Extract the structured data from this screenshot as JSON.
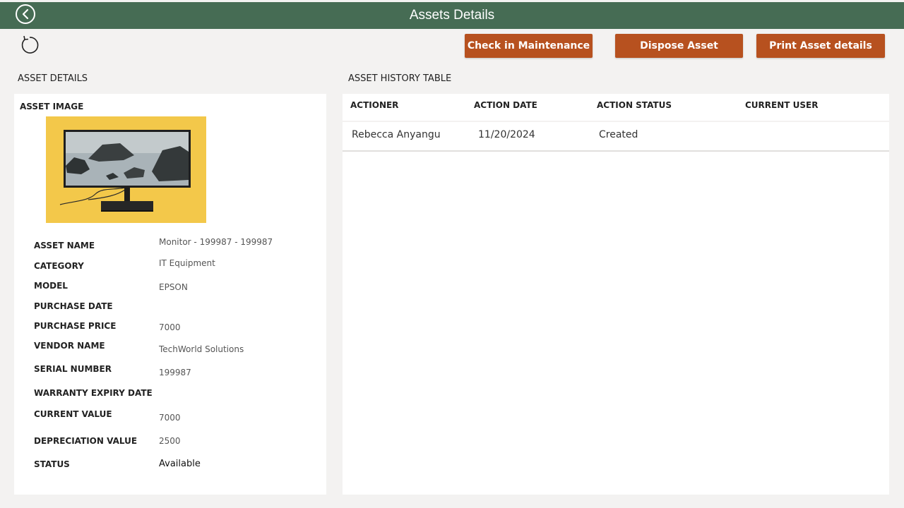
{
  "header": {
    "title": "Assets Details",
    "back_icon": "chevron-left-circle-icon",
    "bg_color": "#466c54"
  },
  "toolbar": {
    "refresh_icon": "refresh-icon",
    "check_maintenance_label": "Check in Maintenance",
    "dispose_label": "Dispose Asset",
    "print_label": "Print Asset details",
    "button_color": "#b7511f"
  },
  "asset_details": {
    "section_title": "ASSET DETAILS",
    "image_title": "ASSET IMAGE",
    "fields": [
      {
        "label": "ASSET NAME",
        "value": "Monitor - 199987 - 199987"
      },
      {
        "label": "CATEGORY",
        "value": "IT Equipment"
      },
      {
        "label": "MODEL",
        "value": "EPSON"
      },
      {
        "label": "PURCHASE DATE",
        "value": ""
      },
      {
        "label": "PURCHASE PRICE",
        "value": "7000"
      },
      {
        "label": "VENDOR NAME",
        "value": "TechWorld Solutions"
      },
      {
        "label": "SERIAL NUMBER",
        "value": "199987"
      },
      {
        "label": "WARRANTY EXPIRY DATE",
        "value": ""
      },
      {
        "label": "CURRENT VALUE",
        "value": "7000"
      },
      {
        "label": "DEPRECIATION VALUE",
        "value": "2500"
      },
      {
        "label": "STATUS",
        "value": "Available"
      }
    ]
  },
  "history": {
    "section_title": "ASSET HISTORY TABLE",
    "columns": [
      "ACTIONER",
      "ACTION DATE",
      "ACTION STATUS",
      "CURRENT USER"
    ],
    "rows": [
      [
        "Rebecca Anyangu",
        "11/20/2024",
        "Created",
        ""
      ]
    ]
  }
}
